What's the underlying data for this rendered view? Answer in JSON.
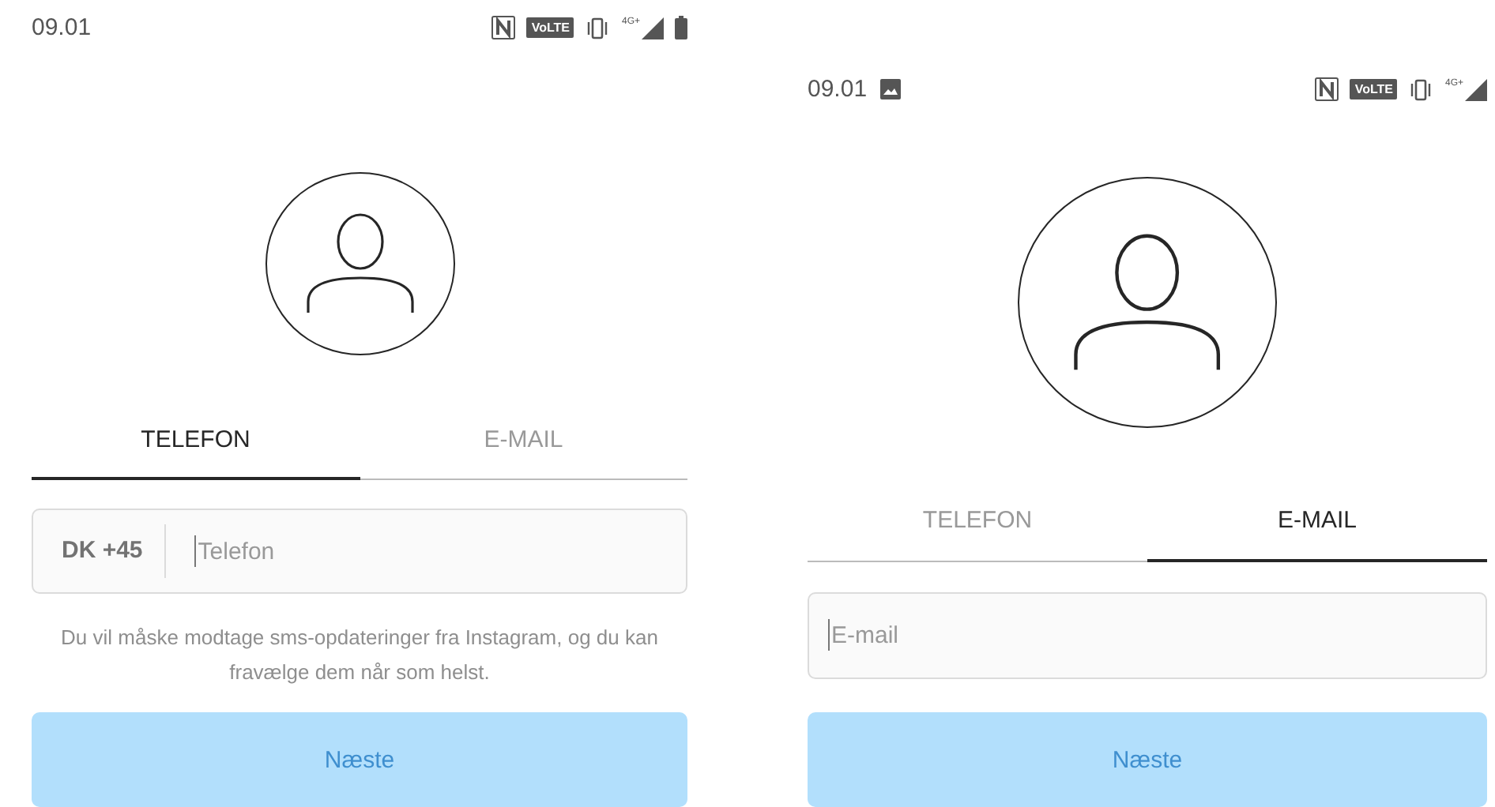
{
  "screens": [
    {
      "status_bar": {
        "time": "09.01",
        "image_notification": false,
        "volte": "VoLTE",
        "network": "4G+",
        "battery": true
      },
      "tabs": [
        {
          "label": "TELEFON",
          "selected": true
        },
        {
          "label": "E-MAIL",
          "selected": false
        }
      ],
      "field": {
        "kind": "phone",
        "prefix": "DK +45",
        "placeholder": "Telefon"
      },
      "hint": "Du vil måske modtage sms-opdateringer fra Instagram, og du kan fravælge dem når som helst.",
      "button": {
        "label": "Næste",
        "disabled": true
      }
    },
    {
      "status_bar": {
        "time": "09.01",
        "image_notification": true,
        "volte": "VoLTE",
        "network": "4G+",
        "battery": false
      },
      "tabs": [
        {
          "label": "TELEFON",
          "selected": false
        },
        {
          "label": "E-MAIL",
          "selected": true
        }
      ],
      "field": {
        "kind": "email",
        "placeholder": "E-mail"
      },
      "button": {
        "label": "Næste",
        "disabled": true
      }
    }
  ]
}
